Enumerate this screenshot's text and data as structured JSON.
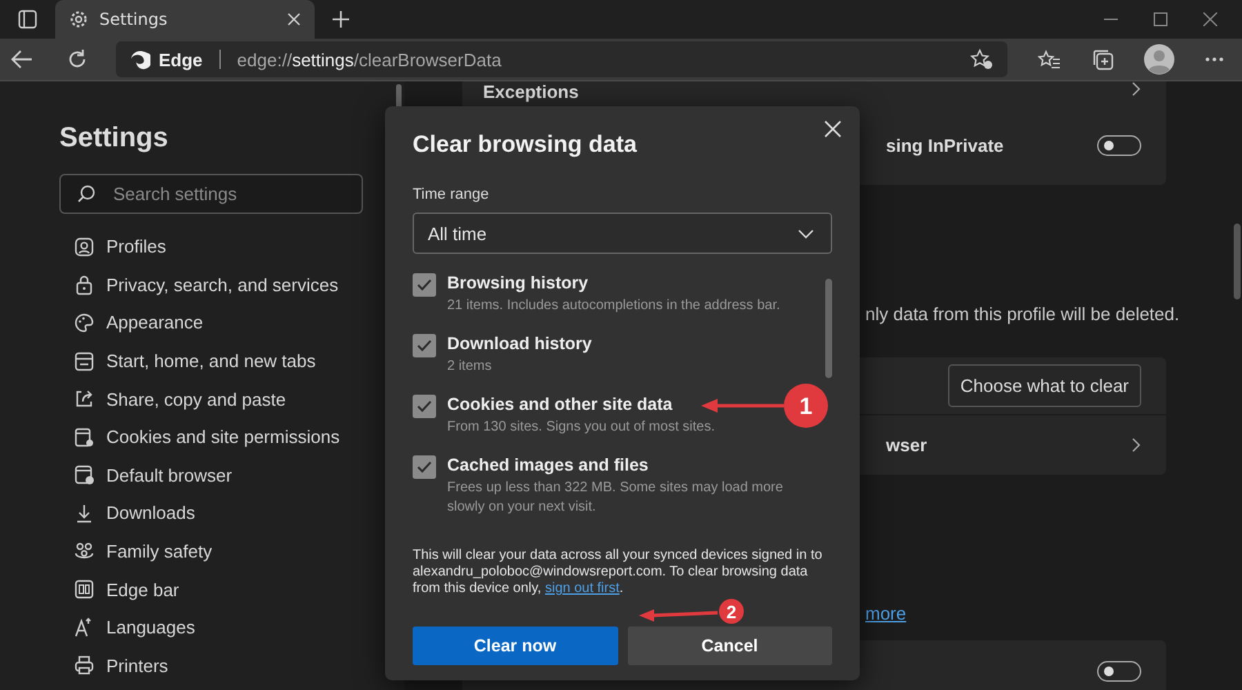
{
  "browser": {
    "tab": {
      "title": "Settings",
      "selected": true
    },
    "address": {
      "brand": "Edge",
      "url_host": "edge://",
      "url_bold": "settings",
      "url_path": "/clearBrowserData"
    }
  },
  "sidebar": {
    "title": "Settings",
    "search": {
      "placeholder": "Search settings"
    },
    "items": [
      {
        "label": "Profiles",
        "selected": false
      },
      {
        "label": "Privacy, search, and services",
        "selected": false
      },
      {
        "label": "Appearance",
        "selected": false
      },
      {
        "label": "Start, home, and new tabs",
        "selected": false
      },
      {
        "label": "Share, copy and paste",
        "selected": false
      },
      {
        "label": "Cookies and site permissions",
        "selected": false
      },
      {
        "label": "Default browser",
        "selected": false
      },
      {
        "label": "Downloads",
        "selected": false
      },
      {
        "label": "Family safety",
        "selected": false
      },
      {
        "label": "Edge bar",
        "selected": false
      },
      {
        "label": "Languages",
        "selected": false
      },
      {
        "label": "Printers",
        "selected": false
      }
    ]
  },
  "background": {
    "exceptions": "Exceptions",
    "inprivate": {
      "label": "sing InPrivate",
      "on": false
    },
    "profile_note": "nly data from this profile will be deleted.",
    "choose_button": "Choose what to clear",
    "browser_row": "wser",
    "more_link": "more",
    "bottom_toggle": {
      "on": false
    }
  },
  "dialog": {
    "title": "Clear browsing data",
    "time_range": {
      "label": "Time range",
      "value": "All time"
    },
    "options": [
      {
        "label": "Browsing history",
        "detail": "21 items. Includes autocompletions in the address bar.",
        "checked": true
      },
      {
        "label": "Download history",
        "detail": "2 items",
        "checked": true
      },
      {
        "label": "Cookies and other site data",
        "detail": "From 130 sites. Signs you out of most sites.",
        "checked": true
      },
      {
        "label": "Cached images and files",
        "detail": "Frees up less than 322 MB. Some sites may load more slowly on your next visit.",
        "checked": true
      }
    ],
    "notice": "This will clear your data across all your synced devices signed in to\nalexandru_poloboc@windowsreport.com. To clear browsing data\nfrom this device only,",
    "notice_link": "sign out first",
    "notice_end": ".",
    "buttons": [
      {
        "label": "Clear now",
        "kind": "primary"
      },
      {
        "label": "Cancel",
        "kind": "secondary"
      }
    ]
  },
  "annotations": [
    {
      "number": "1"
    },
    {
      "number": "2"
    }
  ]
}
